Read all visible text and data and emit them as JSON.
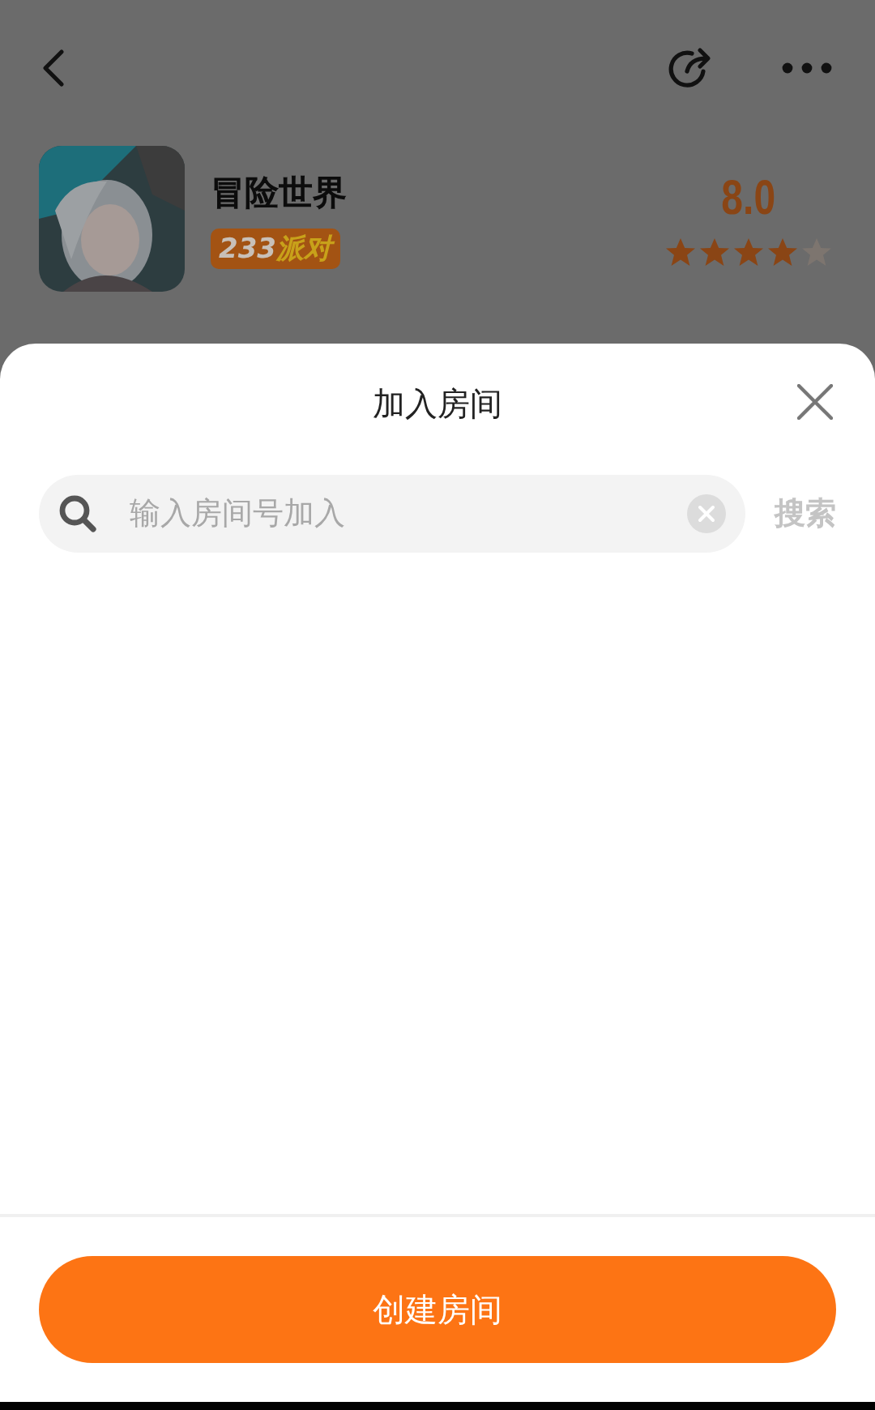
{
  "game": {
    "name": "冒险世界",
    "badge": {
      "number": "233",
      "label": "派对"
    },
    "rating": "8.0",
    "stars": 4
  },
  "sheet": {
    "title": "加入房间",
    "search": {
      "placeholder": "输入房间号加入",
      "button": "搜索"
    },
    "create_button": "创建房间"
  }
}
